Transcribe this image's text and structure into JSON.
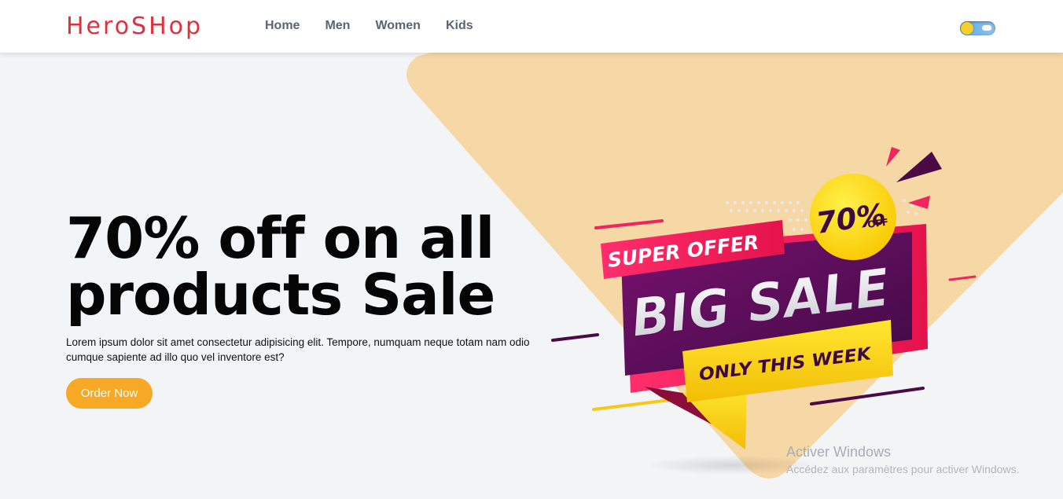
{
  "brand": {
    "logo_text": "HeroSHop"
  },
  "nav": {
    "items": [
      {
        "label": "Home"
      },
      {
        "label": "Men"
      },
      {
        "label": "Women"
      },
      {
        "label": "Kids"
      }
    ]
  },
  "theme_toggle": {
    "state": "light"
  },
  "hero": {
    "title": "70% off on all products Sale",
    "description": "Lorem ipsum dolor sit amet consectetur adipisicing elit. Tempore, numquam neque totam nam odio cumque sapiente ad illo quo vel inventore est?",
    "cta_label": "Order Now"
  },
  "promo_banner": {
    "super_offer": "SUPER OFFER",
    "big_sale": "BIG SALE",
    "only_this_week": "ONLY THIS WEEK",
    "badge_percent": "70%",
    "badge_off": "OFF"
  },
  "colors": {
    "brand_red": "#e0303e",
    "accent_orange": "#f7a825",
    "bg_peach": "#f6d7a6",
    "banner_purple": "#5a0b54",
    "banner_pink": "#f0245e",
    "banner_yellow": "#fbd812"
  },
  "os_watermark": {
    "title": "Activer Windows",
    "subtitle": "Accédez aux paramètres pour activer Windows."
  }
}
